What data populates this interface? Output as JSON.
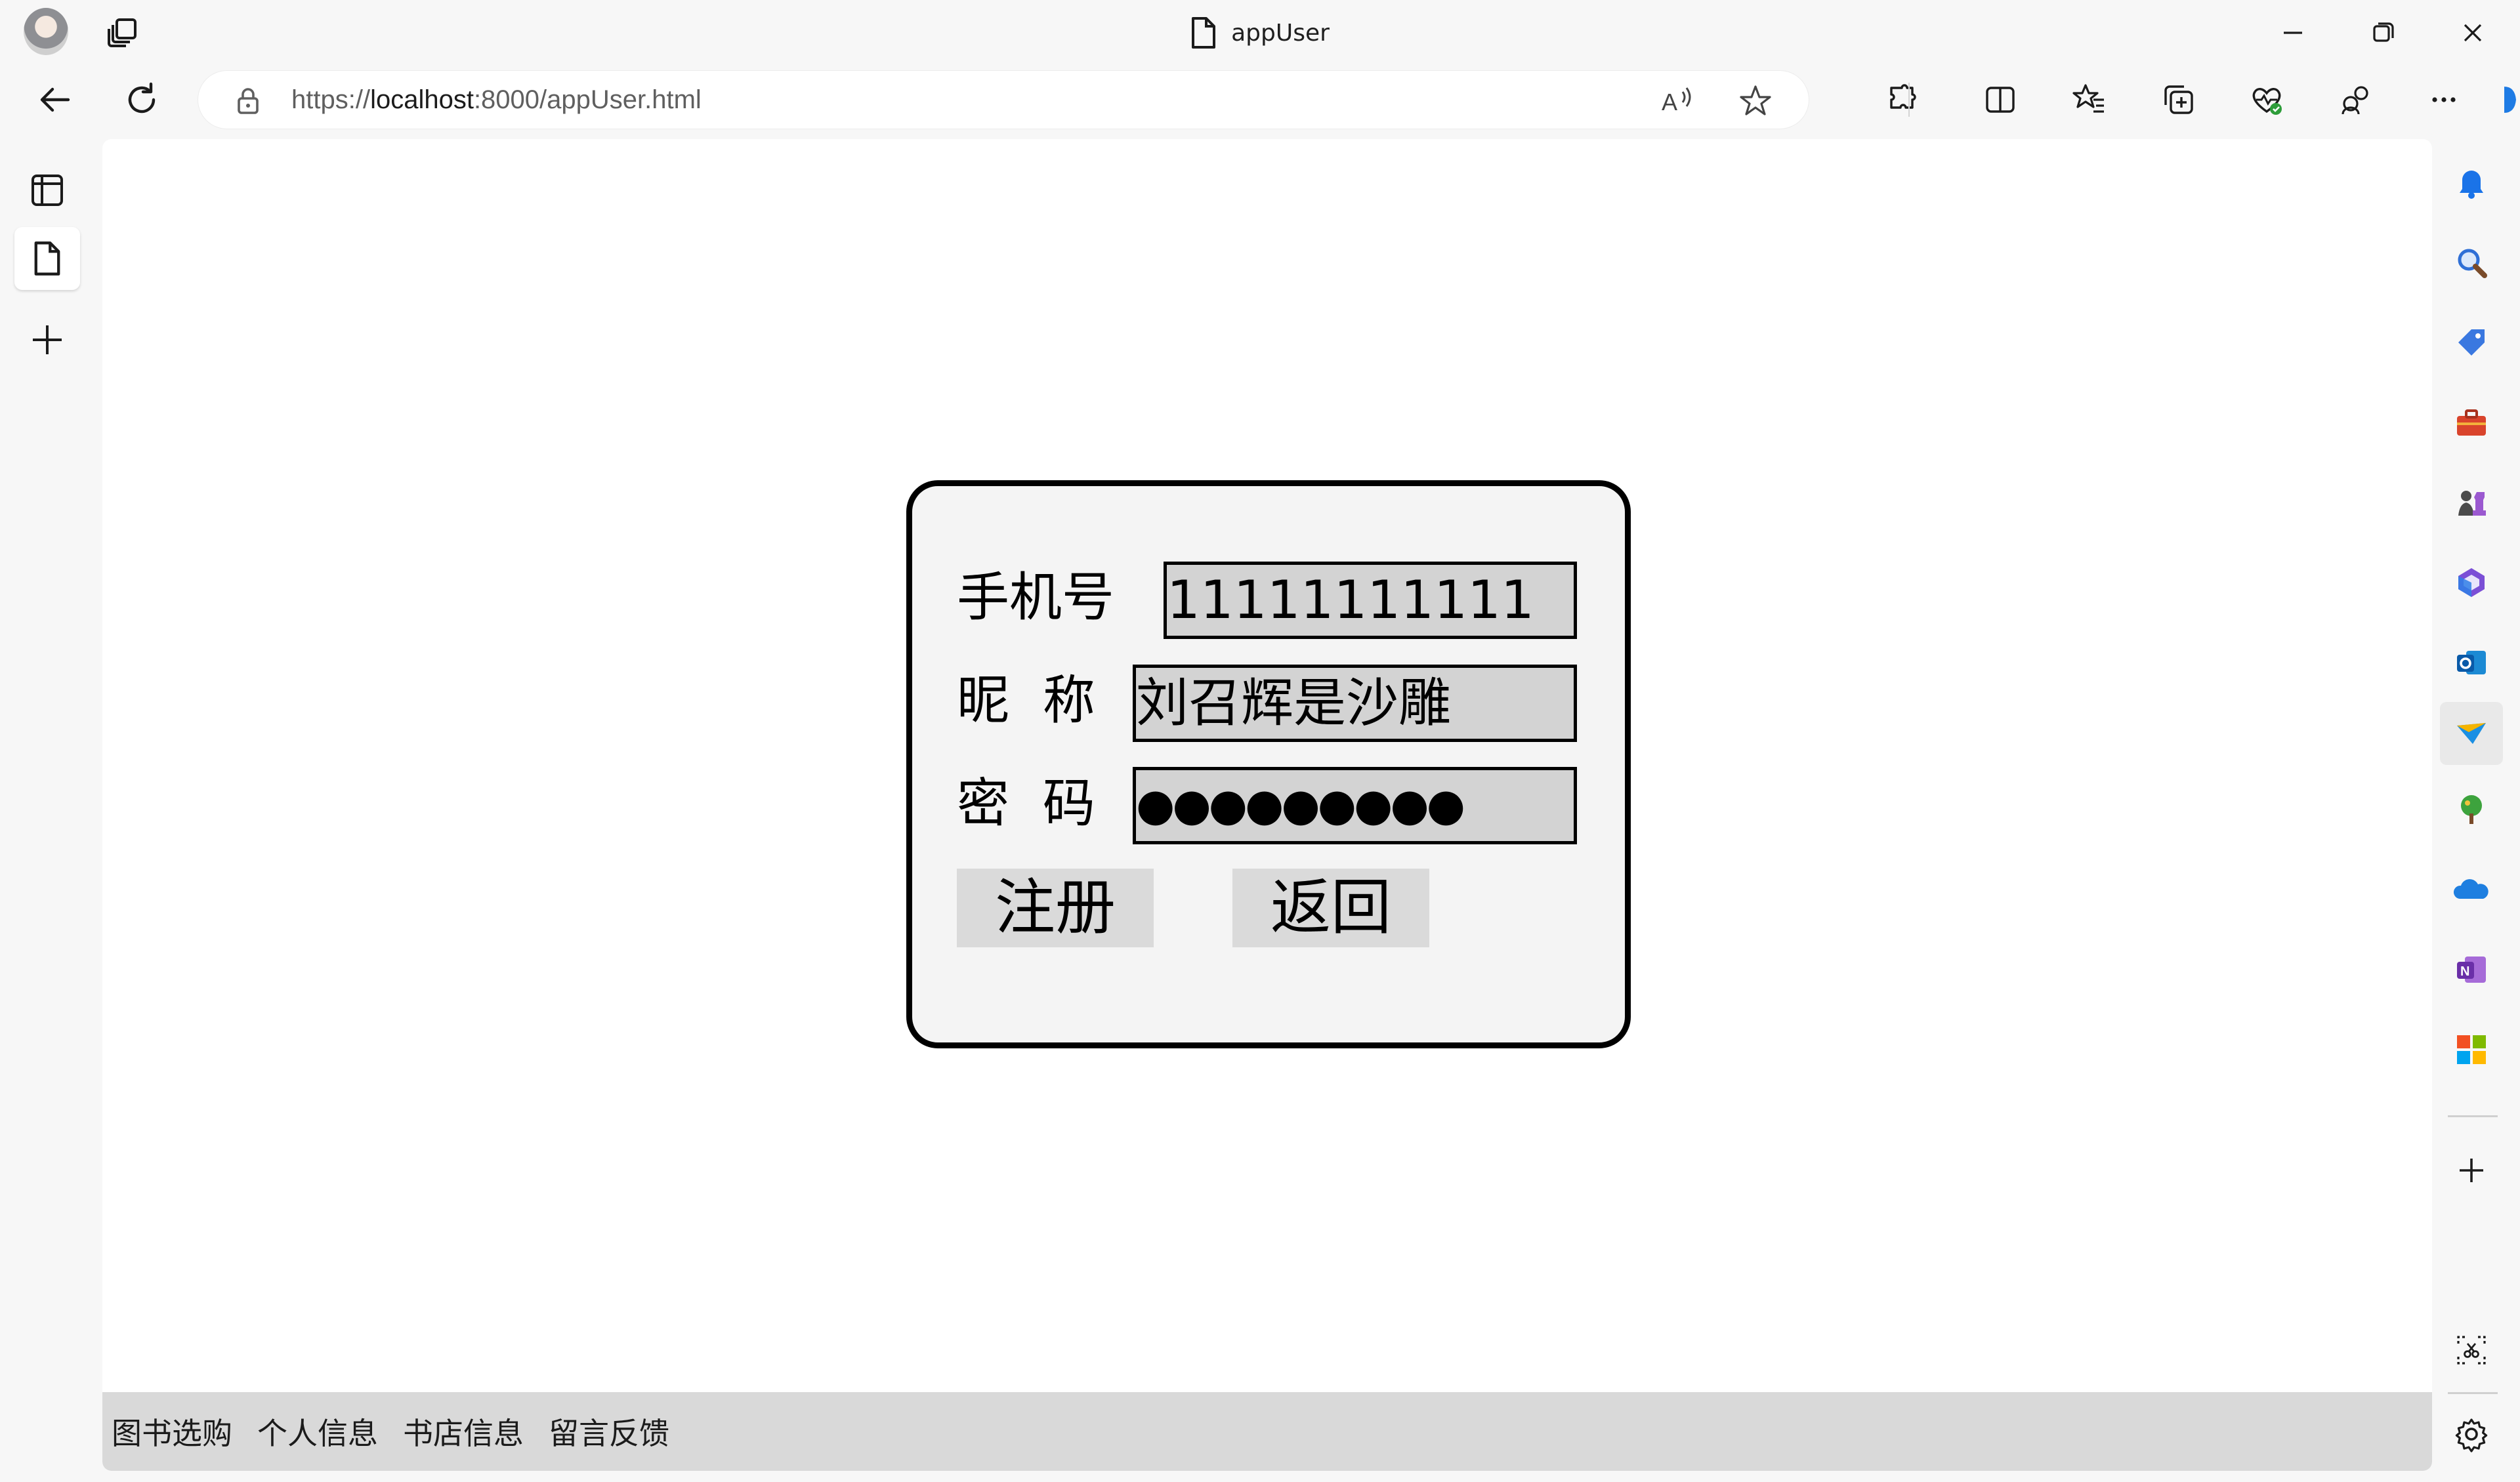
{
  "browser": {
    "tab_title": "appUser",
    "url_prefix": "https://",
    "url_host": "localhost",
    "url_rest": ":8000/appUser.html"
  },
  "form": {
    "phone_label": "手机号",
    "phone_value": "11111111111",
    "nickname_label": "昵  称",
    "nickname_value": "刘召辉是沙雕",
    "password_label": "密  码",
    "password_value": "●●●●●●●●●",
    "register_label": "注册",
    "back_label": "返回"
  },
  "bottom_menu": {
    "items": [
      "图书选购",
      "个人信息",
      "书店信息",
      "留言反馈"
    ]
  },
  "colors": {
    "card_background": "#f4f4f4",
    "card_border": "#000000",
    "field_background": "#d3d3d3",
    "button_background": "#dadada",
    "bottom_menu_background": "#d9d9d9"
  }
}
